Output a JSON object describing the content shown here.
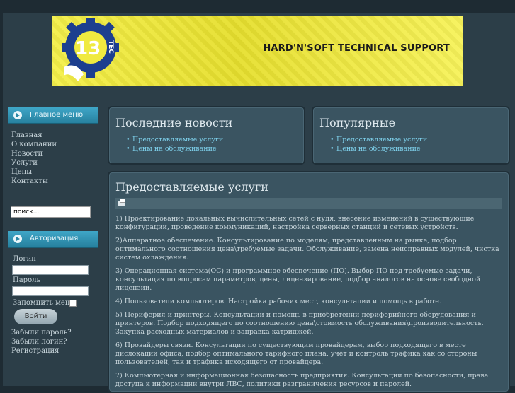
{
  "banner": {
    "logo_text": "13 TEC",
    "title": "HARD'N'SOFT TECHNICAL SUPPORT"
  },
  "main_menu": {
    "title": "Главное меню",
    "items": [
      "Главная",
      "О компании",
      "Новости",
      "Услуги",
      "Цены",
      "Контакты"
    ]
  },
  "search": {
    "value": "поиск..."
  },
  "auth": {
    "title": "Авторизация",
    "login_label": "Логин",
    "password_label": "Пароль",
    "remember_label": "Запомнить меня",
    "submit_label": "Войти",
    "links": [
      "Забыли пароль?",
      "Забыли логин?",
      "Регистрация"
    ]
  },
  "latest_news": {
    "title": "Последние новости",
    "items": [
      "Предоставляемые услуги",
      "Цены на обслуживание"
    ]
  },
  "popular": {
    "title": "Популярные",
    "items": [
      "Предоставляемые услуги",
      "Цены на обслуживание"
    ]
  },
  "article": {
    "title": "Предоставляемые услуги",
    "paragraphs": [
      "1) Проектирование локальных вычислительных сетей с нуля, внесение изменений в существующие конфигурации, проведение коммуникаций, настройка серверных станций и сетевых устройств.",
      "2)Аппаратное обеспечение. Консультирование по моделям, представленным на рынке, подбор оптимального соотношения цена\\требуемые задачи. Обслуживание, замена неисправных модулей, чистка систем охлаждения.",
      "3) Операционная система(ОС) и программное обеспечение (ПО). Выбор ПО под требуемые задачи, консультация по вопросам параметров, цены, лицензирование, подбор аналогов на основе свободной лицензии.",
      "4) Пользователи компьютеров. Настройка рабочих мест, консультации и помощь в работе.",
      "5) Периферия и принтеры. Консультации и помощь в приобретении периферийного оборудования и принтеров. Подбор подходящего по соотношению цена\\стоимость обслуживания\\производительность. Закупка расходных материалов и заправка катриджей.",
      "6) Провайдеры связи. Консультации по существующим провайдерам, выбор подходящего в месте дислокации офиса, подбор оптимального тарифного плана, учёт и контроль трафика как со стороны пользователей, так и трафика исходящего от провайдера.",
      "7) Компьютерная и информационная безопасность предприятия. Консультации по безопасности, права доступа к информации внутри ЛВС, политики разграничения ресурсов и паролей."
    ]
  },
  "colors": {
    "accent": "#3fa6c7",
    "link": "#7fd3ee",
    "panel": "#3a5461",
    "background": "#2c3e48",
    "banner": "#f4ef4a"
  }
}
